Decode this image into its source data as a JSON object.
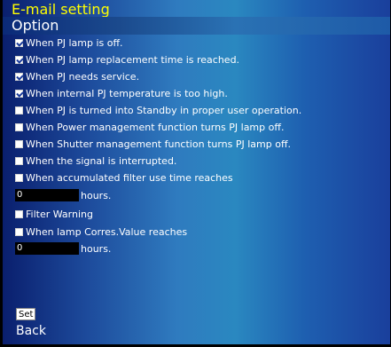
{
  "page": {
    "title": "E-mail setting",
    "section": "Option"
  },
  "options": [
    {
      "label": "When PJ lamp is off.",
      "checked": true
    },
    {
      "label": "When PJ lamp replacement time is reached.",
      "checked": true
    },
    {
      "label": "When PJ needs service.",
      "checked": true
    },
    {
      "label": "When internal PJ temperature is too high.",
      "checked": true
    },
    {
      "label": "When PJ is turned into Standby in proper user operation.",
      "checked": false
    },
    {
      "label": "When Power management function turns PJ lamp off.",
      "checked": false
    },
    {
      "label": "When Shutter management function turns PJ lamp off.",
      "checked": false
    },
    {
      "label": "When the signal is interrupted.",
      "checked": false
    },
    {
      "label": "When accumulated filter use time reaches",
      "checked": false
    }
  ],
  "filter_hours": {
    "value": "0",
    "unit": "hours."
  },
  "filter_warning": {
    "label": "Filter Warning",
    "checked": false
  },
  "lamp_corres": {
    "label": "When lamp Corres.Value reaches",
    "checked": false
  },
  "lamp_hours": {
    "value": "0",
    "unit": "hours."
  },
  "actions": {
    "set_label": "Set",
    "back_label": "Back"
  },
  "colors": {
    "title": "#ffff00",
    "check_mark": "#1a3a9a"
  }
}
